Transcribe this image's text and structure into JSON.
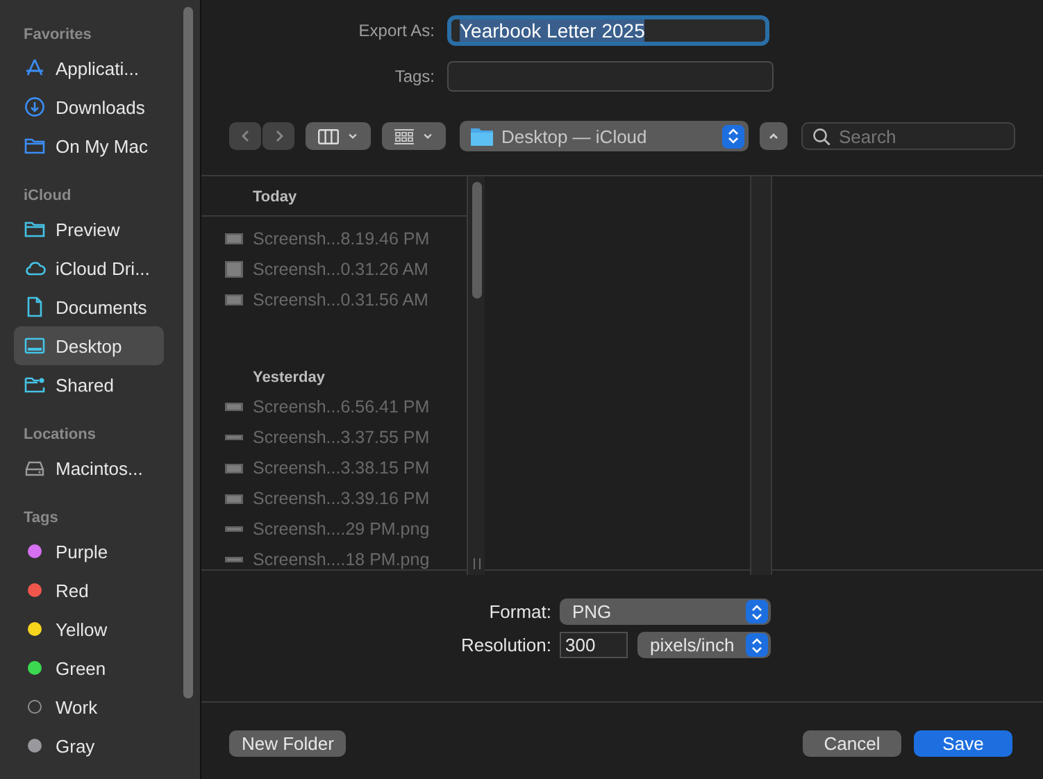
{
  "sidebar": {
    "sections": [
      {
        "title": "Favorites",
        "items": [
          {
            "label": "Applicati...",
            "selected": false
          },
          {
            "label": "Downloads",
            "selected": false
          },
          {
            "label": "On My Mac",
            "selected": false
          }
        ]
      },
      {
        "title": "iCloud",
        "items": [
          {
            "label": "Preview",
            "selected": false
          },
          {
            "label": "iCloud Dri...",
            "selected": false
          },
          {
            "label": "Documents",
            "selected": false
          },
          {
            "label": "Desktop",
            "selected": true
          },
          {
            "label": "Shared",
            "selected": false
          }
        ]
      },
      {
        "title": "Locations",
        "items": [
          {
            "label": "Macintos...",
            "selected": false
          }
        ]
      }
    ],
    "tags": {
      "title": "Tags",
      "items": [
        {
          "label": "Purple",
          "color": "#d66ff0",
          "kind": "dot"
        },
        {
          "label": "Red",
          "color": "#f0564c",
          "kind": "dot"
        },
        {
          "label": "Yellow",
          "color": "#f7d51d",
          "kind": "dot"
        },
        {
          "label": "Green",
          "color": "#3bd94f",
          "kind": "dot"
        },
        {
          "label": "Work",
          "color": "#8e8e93",
          "kind": "ring"
        },
        {
          "label": "Gray",
          "color": "#98989d",
          "kind": "dot"
        }
      ]
    }
  },
  "export_as": {
    "label": "Export As:",
    "value": "Yearbook Letter 2025"
  },
  "tags_field": {
    "label": "Tags:"
  },
  "toolbar": {
    "location": "Desktop — iCloud",
    "search": {
      "placeholder": "Search"
    }
  },
  "file_groups": [
    {
      "title": "Today",
      "files": [
        {
          "name": "Screensh...8.19.46 PM",
          "disabled": true
        },
        {
          "name": "Screensh...0.31.26 AM",
          "disabled": true
        },
        {
          "name": "Screensh...0.31.56 AM",
          "disabled": true
        }
      ]
    },
    {
      "title": "Yesterday",
      "files": [
        {
          "name": "Screensh...6.56.41 PM",
          "disabled": true
        },
        {
          "name": "Screensh...3.37.55 PM",
          "disabled": true
        },
        {
          "name": "Screensh...3.38.15 PM",
          "disabled": true
        },
        {
          "name": "Screensh...3.39.16 PM",
          "disabled": true
        },
        {
          "name": "Screensh....29 PM.png",
          "disabled": true
        },
        {
          "name": "Screensh....18 PM.png",
          "disabled": true
        }
      ]
    }
  ],
  "options": {
    "format": {
      "label": "Format:",
      "value": "PNG"
    },
    "resolution": {
      "label": "Resolution:",
      "value": "300",
      "unit": "pixels/inch"
    }
  },
  "buttons": {
    "new_folder": "New Folder",
    "cancel": "Cancel",
    "save": "Save"
  }
}
